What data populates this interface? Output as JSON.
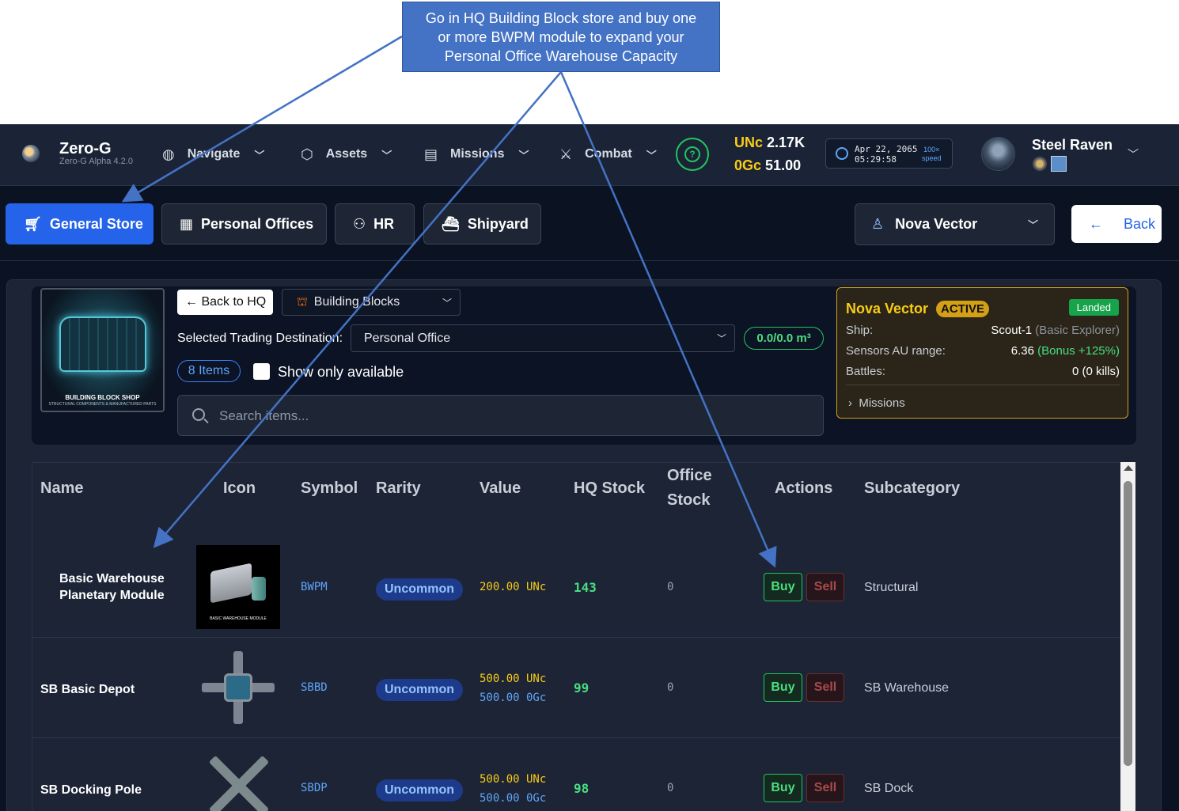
{
  "annotation": {
    "callout_lines": [
      "Go in HQ Building Block store and buy one",
      "or more BWPM module to expand your",
      "Personal Office Warehouse Capacity"
    ],
    "callout_color": "#4472c4"
  },
  "brand": {
    "name": "Zero-G",
    "version": "Zero-G Alpha 4.2.0"
  },
  "nav": {
    "items": [
      {
        "label": "Navigate",
        "icon": "globe-icon"
      },
      {
        "label": "Assets",
        "icon": "cube-icon"
      },
      {
        "label": "Missions",
        "icon": "scroll-icon"
      },
      {
        "label": "Combat",
        "icon": "crossed-swords-icon"
      }
    ]
  },
  "currency": {
    "unc_label": "UNc",
    "unc_value": "2.17K",
    "ogc_label": "0Gc",
    "ogc_value": "51.00"
  },
  "clock": {
    "date": "Apr 22, 2065",
    "time": "05:29:58",
    "speed_value": "100×",
    "speed_label": "speed"
  },
  "user": {
    "name": "Steel Raven"
  },
  "tabs": [
    {
      "label": "General Store",
      "active": true,
      "icon": "cart-icon"
    },
    {
      "label": "Personal Offices",
      "active": false,
      "icon": "building-icon"
    },
    {
      "label": "HR",
      "active": false,
      "icon": "users-icon"
    },
    {
      "label": "Shipyard",
      "active": false,
      "icon": "ship-icon"
    }
  ],
  "character_select": {
    "value": "Nova Vector"
  },
  "back_button": {
    "label": "Back"
  },
  "shop": {
    "image_title": "BUILDING BLOCK SHOP",
    "image_subtitle": "STRUCTURAL COMPONENTS & MANUFACTURED PARTS",
    "back_to_hq": "← Back to HQ",
    "category": "Building Blocks",
    "destination_label": "Selected Trading Destination:",
    "destination_value": "Personal Office",
    "capacity": "0.0/0.0 m³",
    "items_count": "8 Items",
    "show_available_label": "Show only available",
    "show_available_checked": false,
    "search_placeholder": "Search items..."
  },
  "character_card": {
    "name": "Nova Vector",
    "status": "ACTIVE",
    "location_status": "Landed",
    "ship_label": "Ship:",
    "ship_value": "Scout-1",
    "ship_class": "(Basic Explorer)",
    "sensors_label": "Sensors AU range:",
    "sensors_value": "6.36",
    "sensors_bonus": "(Bonus +125%)",
    "battles_label": "Battles:",
    "battles_value": "0 (0 kills)",
    "missions_label": "Missions"
  },
  "table": {
    "headers": {
      "name": "Name",
      "icon": "Icon",
      "symbol": "Symbol",
      "rarity": "Rarity",
      "value": "Value",
      "hq_stock": "HQ Stock",
      "office_stock_1": "Office",
      "office_stock_2": "Stock",
      "actions": "Actions",
      "subcategory": "Subcategory"
    },
    "rows": [
      {
        "name_line1": "Basic Warehouse",
        "name_line2": "Planetary Module",
        "icon_label": "BASIC WAREHOUSE MODULE",
        "symbol": "BWPM",
        "rarity": "Uncommon",
        "value_unc": "200.00 UNc",
        "value_ogc": "",
        "hq_stock": "143",
        "office_stock": "0",
        "buy": "Buy",
        "sell": "Sell",
        "subcategory": "Structural"
      },
      {
        "name_line1": "SB Basic Depot",
        "name_line2": "",
        "icon_label": "",
        "symbol": "SBBD",
        "rarity": "Uncommon",
        "value_unc": "500.00 UNc",
        "value_ogc": "500.00 0Gc",
        "hq_stock": "99",
        "office_stock": "0",
        "buy": "Buy",
        "sell": "Sell",
        "subcategory": "SB Warehouse"
      },
      {
        "name_line1": "SB Docking Pole",
        "name_line2": "",
        "icon_label": "",
        "symbol": "SBDP",
        "rarity": "Uncommon",
        "value_unc": "500.00 UNc",
        "value_ogc": "500.00 0Gc",
        "hq_stock": "98",
        "office_stock": "0",
        "buy": "Buy",
        "sell": "Sell",
        "subcategory": "SB Dock"
      }
    ]
  }
}
